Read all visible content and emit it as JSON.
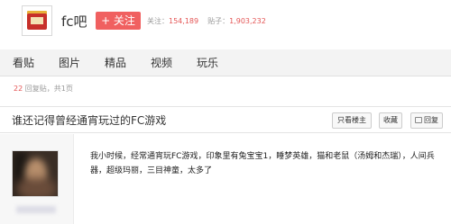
{
  "header": {
    "forum_name": "fc吧",
    "follow_label": "+ 关注",
    "followers_label": "关注：",
    "followers_value": "154,189",
    "posts_label": "贴子：",
    "posts_value": "1,903,232"
  },
  "tabs": [
    {
      "label": "看贴"
    },
    {
      "label": "图片"
    },
    {
      "label": "精品"
    },
    {
      "label": "视频"
    },
    {
      "label": "玩乐"
    }
  ],
  "meta": {
    "reply_count": "22",
    "reply_text": " 回复贴，共1页"
  },
  "thread": {
    "title": "谁还记得曾经通宵玩过的FC游戏",
    "buttons": {
      "owner_only": "只看楼主",
      "favorite": "收藏",
      "reply": "回复"
    }
  },
  "post": {
    "content": "我小时候，经常通宵玩FC游戏，印象里有兔宝宝1，睡梦英雄，猫和老鼠（汤姆和杰瑞），人间兵器，超级玛丽，三目神童，太多了"
  },
  "colors": {
    "accent_red": "#f06060",
    "stat_red": "#e45555"
  }
}
